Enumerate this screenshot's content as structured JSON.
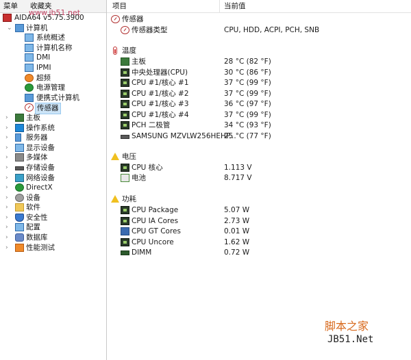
{
  "tabs": {
    "active": "菜单",
    "other": "收藏夹"
  },
  "watermark_top": "www.jb51.net",
  "tree": {
    "app": "AIDA64 v5.75.3900",
    "computer": "计算机",
    "computer_children": [
      "系统概述",
      "计算机名称",
      "DMI",
      "IPMI",
      "超频",
      "电源管理",
      "便携式计算机",
      "传感器"
    ],
    "categories": [
      "主板",
      "操作系统",
      "服务器",
      "显示设备",
      "多媒体",
      "存储设备",
      "网络设备",
      "DirectX",
      "设备",
      "软件",
      "安全性",
      "配置",
      "数据库",
      "性能测试"
    ]
  },
  "header": {
    "col1": "项目",
    "col2": "当前值"
  },
  "sensor_group": {
    "title": "传感器",
    "type_label": "传感器类型",
    "type_value": "CPU, HDD, ACPI, PCH, SNB"
  },
  "temperature": {
    "title": "温度",
    "items": [
      {
        "label": "主板",
        "value": "28 °C  (82 °F)"
      },
      {
        "label": "中央处理器(CPU)",
        "value": "30 °C  (86 °F)"
      },
      {
        "label": "CPU #1/核心 #1",
        "value": "37 °C  (99 °F)"
      },
      {
        "label": "CPU #1/核心 #2",
        "value": "37 °C  (99 °F)"
      },
      {
        "label": "CPU #1/核心 #3",
        "value": "36 °C  (97 °F)"
      },
      {
        "label": "CPU #1/核心 #4",
        "value": "37 °C  (99 °F)"
      },
      {
        "label": "PCH 二极管",
        "value": "34 °C  (93 °F)"
      },
      {
        "label": "SAMSUNG MZVLW256HEHP...",
        "value": "25 °C  (77 °F)"
      }
    ]
  },
  "voltage": {
    "title": "电压",
    "items": [
      {
        "label": "CPU 核心",
        "value": "1.113 V"
      },
      {
        "label": "电池",
        "value": "8.717 V"
      }
    ]
  },
  "power": {
    "title": "功耗",
    "items": [
      {
        "label": "CPU Package",
        "value": "5.07 W"
      },
      {
        "label": "CPU IA Cores",
        "value": "2.73 W"
      },
      {
        "label": "CPU GT Cores",
        "value": "0.01 W"
      },
      {
        "label": "CPU Uncore",
        "value": "1.62 W"
      },
      {
        "label": "DIMM",
        "value": "0.72 W"
      }
    ]
  },
  "watermark": {
    "line1": "脚本之家",
    "line2": "JB51.Net"
  }
}
